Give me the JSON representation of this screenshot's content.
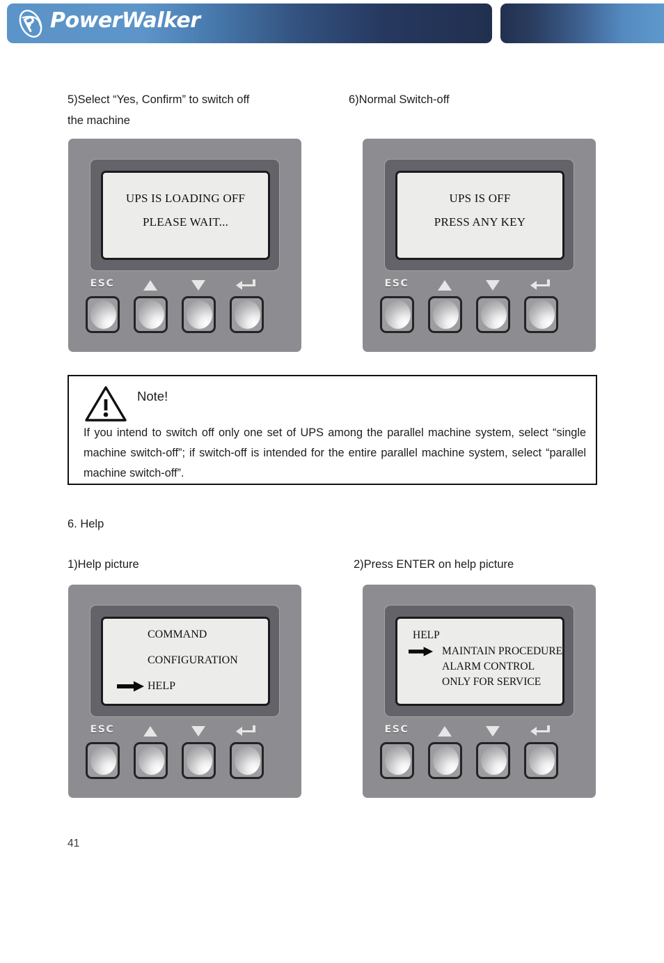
{
  "header": {
    "brand": "PowerWalker",
    "logo_icon": "powerwalker-ellipse-logo"
  },
  "captions": {
    "step5": "5)Select “Yes, Confirm” to switch off\nthe machine",
    "step6": "6)Normal Switch-off",
    "section_help": "6. Help",
    "help1": "1)Help picture",
    "help2": "2)Press ENTER on help picture"
  },
  "panels": [
    {
      "id": "panel-loading-off",
      "display_type": "centered",
      "lines": [
        "UPS IS LOADING OFF",
        "PLEASE WAIT..."
      ],
      "keys": {
        "esc": "ESC",
        "up_icon": "triangle-up-icon",
        "down_icon": "triangle-down-icon",
        "enter_icon": "enter-return-icon"
      }
    },
    {
      "id": "panel-ups-off",
      "display_type": "centered",
      "lines": [
        "UPS IS OFF",
        "PRESS ANY KEY"
      ],
      "keys": {
        "esc": "ESC",
        "up_icon": "triangle-up-icon",
        "down_icon": "triangle-down-icon",
        "enter_icon": "enter-return-icon"
      }
    },
    {
      "id": "panel-main-menu",
      "display_type": "menu",
      "rows": [
        {
          "label": "COMMAND",
          "selected": false
        },
        {
          "label": "CONFIGURATION",
          "selected": false
        },
        {
          "label": "HELP",
          "selected": true
        }
      ],
      "keys": {
        "esc": "ESC",
        "up_icon": "triangle-up-icon",
        "down_icon": "triangle-down-icon",
        "enter_icon": "enter-return-icon"
      }
    },
    {
      "id": "panel-help-menu",
      "display_type": "menu-tight",
      "rows": [
        {
          "label": "HELP",
          "selected": false,
          "header": true
        },
        {
          "label": "MAINTAIN PROCEDURE",
          "selected": true
        },
        {
          "label": "ALARM CONTROL",
          "selected": false
        },
        {
          "label": "ONLY FOR SERVICE",
          "selected": false
        }
      ],
      "keys": {
        "esc": "ESC",
        "up_icon": "triangle-up-icon",
        "down_icon": "triangle-down-icon",
        "enter_icon": "enter-return-icon"
      }
    }
  ],
  "note": {
    "icon": "warning-triangle-icon",
    "title": "Note!",
    "body": "If you intend to switch off only one set of UPS among the parallel machine system, select “single machine switch-off”; if switch-off is intended for the entire parallel machine system, select “parallel machine switch-off”."
  },
  "footer": {
    "page_number": "41"
  },
  "colors": {
    "header_light_blue": "#5b94c8",
    "header_dark_navy": "#22304f",
    "panel_gray": "#8d8d91",
    "bezel_gray": "#636369",
    "lcd_screen": "#ececea",
    "text_black": "#1d1d1d"
  }
}
